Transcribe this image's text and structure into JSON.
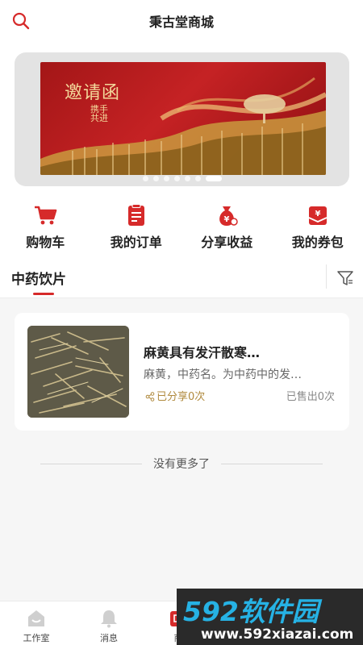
{
  "header": {
    "title": "秉古堂商城",
    "search_icon": "search-icon"
  },
  "banner": {
    "headline": "邀请函",
    "sub_lines": [
      "携手",
      "共进"
    ],
    "dots": 7,
    "active_dot": 6
  },
  "quick_actions": [
    {
      "label": "购物车",
      "icon": "shopping-cart-icon"
    },
    {
      "label": "我的订单",
      "icon": "order-list-icon"
    },
    {
      "label": "分享收益",
      "icon": "money-bag-icon"
    },
    {
      "label": "我的券包",
      "icon": "coupon-wallet-icon"
    }
  ],
  "category_tab": {
    "label": "中药饮片",
    "filter_icon": "filter-icon"
  },
  "product": {
    "name": "麻黄具有发汗散寒…",
    "description": "麻黄，中药名。为中药中的发…",
    "shared": "已分享0次",
    "sold": "已售出0次"
  },
  "no_more": "没有更多了",
  "tabbar": [
    {
      "label": "工作室",
      "icon": "home-icon"
    },
    {
      "label": "消息",
      "icon": "bell-icon"
    },
    {
      "label": "商",
      "icon": "shop-icon"
    }
  ],
  "watermark": {
    "brand": "592软件园",
    "url": "www.592xiazai.com"
  },
  "colors": {
    "accent": "#d62a2a",
    "gold": "#b08a3e",
    "banner_red": "#b31b1e"
  }
}
